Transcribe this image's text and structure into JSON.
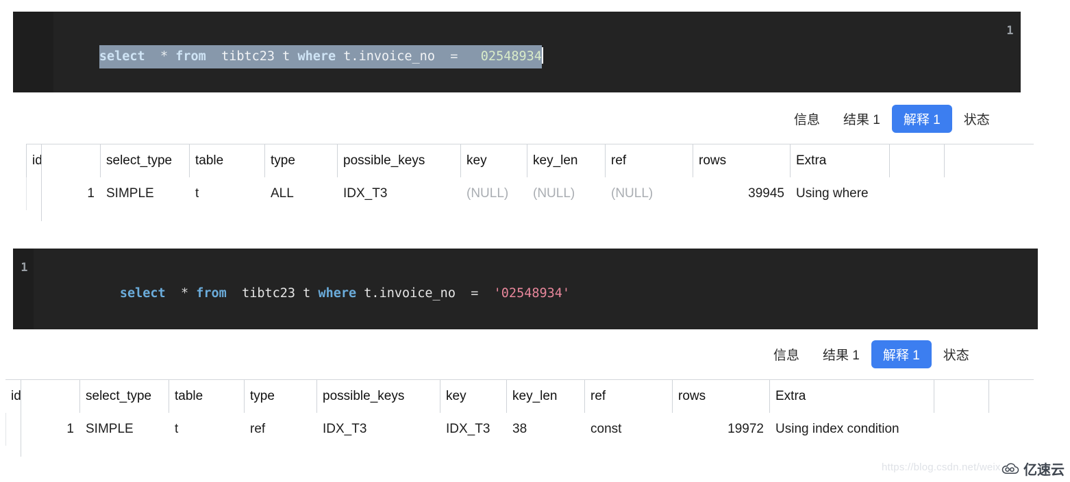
{
  "editor_one": {
    "line_number": "1",
    "tokens": [
      {
        "t": "select",
        "k": "kw"
      },
      {
        "t": "  ",
        "k": "op"
      },
      {
        "t": "*",
        "k": "op"
      },
      {
        "t": " ",
        "k": "op"
      },
      {
        "t": "from",
        "k": "kw"
      },
      {
        "t": "  ",
        "k": "op"
      },
      {
        "t": "tibtc23",
        "k": "id"
      },
      {
        "t": " ",
        "k": "op"
      },
      {
        "t": "t",
        "k": "id"
      },
      {
        "t": " ",
        "k": "op"
      },
      {
        "t": "where",
        "k": "kw"
      },
      {
        "t": " ",
        "k": "op"
      },
      {
        "t": "t.invoice_no",
        "k": "id"
      },
      {
        "t": "  ",
        "k": "op"
      },
      {
        "t": "=",
        "k": "op"
      },
      {
        "t": "   ",
        "k": "op"
      },
      {
        "t": "02548934",
        "k": "num"
      }
    ],
    "plain_text": "select  * from  tibtc23 t where t.invoice_no  =   02548934",
    "selected": true
  },
  "editor_two": {
    "line_number": "1",
    "tokens": [
      {
        "t": "select",
        "k": "kw"
      },
      {
        "t": "  ",
        "k": "op"
      },
      {
        "t": "*",
        "k": "op"
      },
      {
        "t": " ",
        "k": "op"
      },
      {
        "t": "from",
        "k": "kw"
      },
      {
        "t": "  ",
        "k": "op"
      },
      {
        "t": "tibtc23",
        "k": "id"
      },
      {
        "t": " ",
        "k": "op"
      },
      {
        "t": "t",
        "k": "id"
      },
      {
        "t": " ",
        "k": "op"
      },
      {
        "t": "where",
        "k": "kw"
      },
      {
        "t": " ",
        "k": "op"
      },
      {
        "t": "t.invoice_no",
        "k": "id"
      },
      {
        "t": "  ",
        "k": "op"
      },
      {
        "t": "=",
        "k": "op"
      },
      {
        "t": "  ",
        "k": "op"
      },
      {
        "t": "'02548934'",
        "k": "str"
      }
    ],
    "plain_text": "select  * from  tibtc23 t where t.invoice_no  =  '02548934'",
    "selected": false
  },
  "tabs": {
    "items": [
      {
        "label": "信息",
        "active": false
      },
      {
        "label": "结果 1",
        "active": false
      },
      {
        "label": "解释 1",
        "active": true
      },
      {
        "label": "状态",
        "active": false
      }
    ],
    "active_color": "#3c7ef0"
  },
  "explain_table_one": {
    "columns": [
      "id",
      "select_type",
      "table",
      "type",
      "possible_keys",
      "key",
      "key_len",
      "ref",
      "rows",
      "Extra"
    ],
    "rows": [
      {
        "id": "1",
        "select_type": "SIMPLE",
        "table": "t",
        "type": "ALL",
        "possible_keys": "IDX_T3",
        "key": "(NULL)",
        "key_len": "(NULL)",
        "ref": "(NULL)",
        "rows": "39945",
        "Extra": "Using where"
      }
    ]
  },
  "explain_table_two": {
    "columns": [
      "id",
      "select_type",
      "table",
      "type",
      "possible_keys",
      "key",
      "key_len",
      "ref",
      "rows",
      "Extra"
    ],
    "rows": [
      {
        "id": "1",
        "select_type": "SIMPLE",
        "table": "t",
        "type": "ref",
        "possible_keys": "IDX_T3",
        "key": "IDX_T3",
        "key_len": "38",
        "ref": "const",
        "rows": "19972",
        "Extra": "Using index condition"
      }
    ]
  },
  "watermark": {
    "url": "https://blog.csdn.net/weix",
    "brand": "亿速云"
  }
}
